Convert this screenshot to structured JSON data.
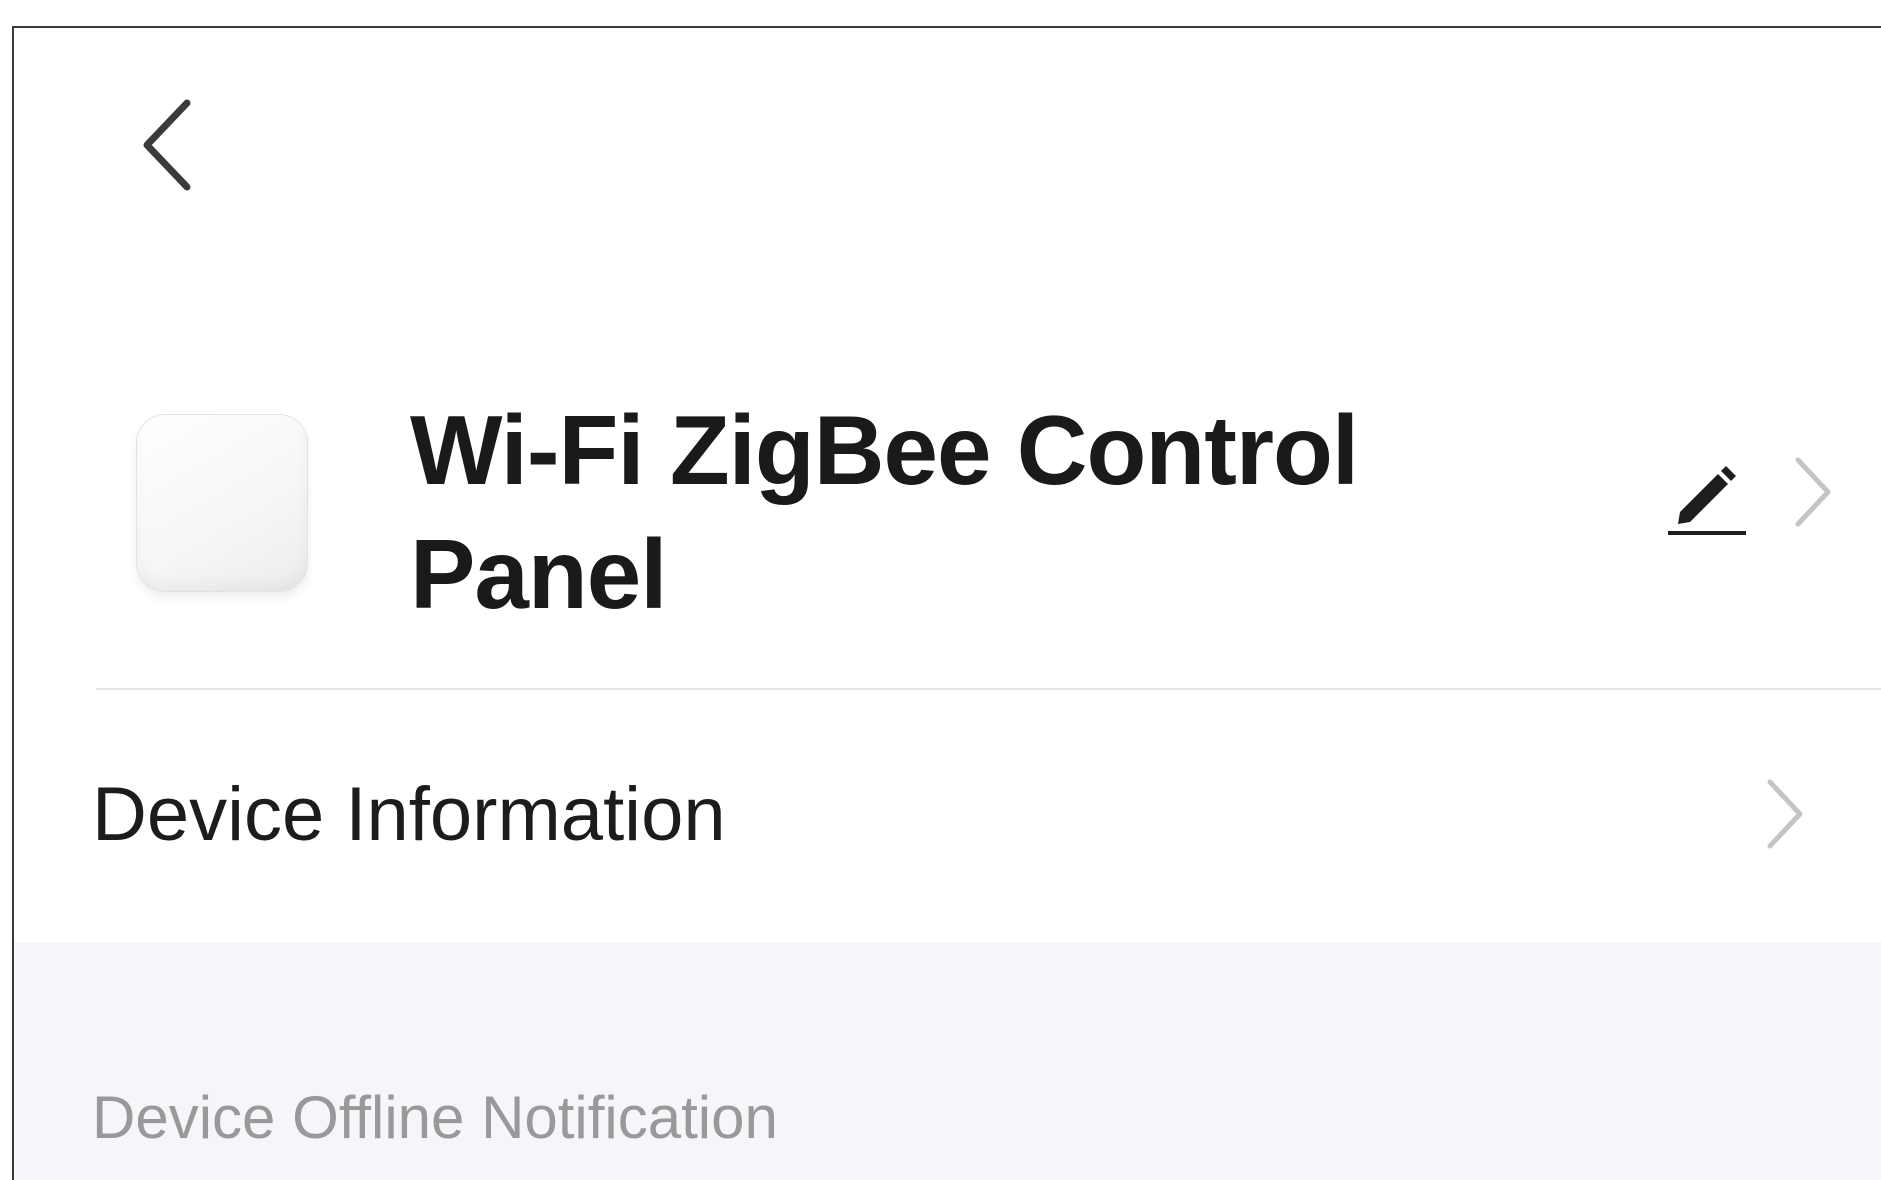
{
  "nav": {
    "back_icon": "chevron-left-icon"
  },
  "device": {
    "name": "Wi-Fi ZigBee Control Panel",
    "edit_icon": "pencil-icon",
    "chevron_icon": "chevron-right-icon"
  },
  "rows": {
    "device_information": {
      "label": "Device Information",
      "chevron_icon": "chevron-right-icon"
    }
  },
  "sections": {
    "offline_notification": {
      "title": "Device Offline Notification"
    }
  },
  "colors": {
    "background": "#ffffff",
    "section_background": "#f5f6f9",
    "primary_text": "#1a1a1a",
    "secondary_text": "#999999",
    "chevron": "#c4c4c4",
    "divider": "#e4e4e4"
  }
}
